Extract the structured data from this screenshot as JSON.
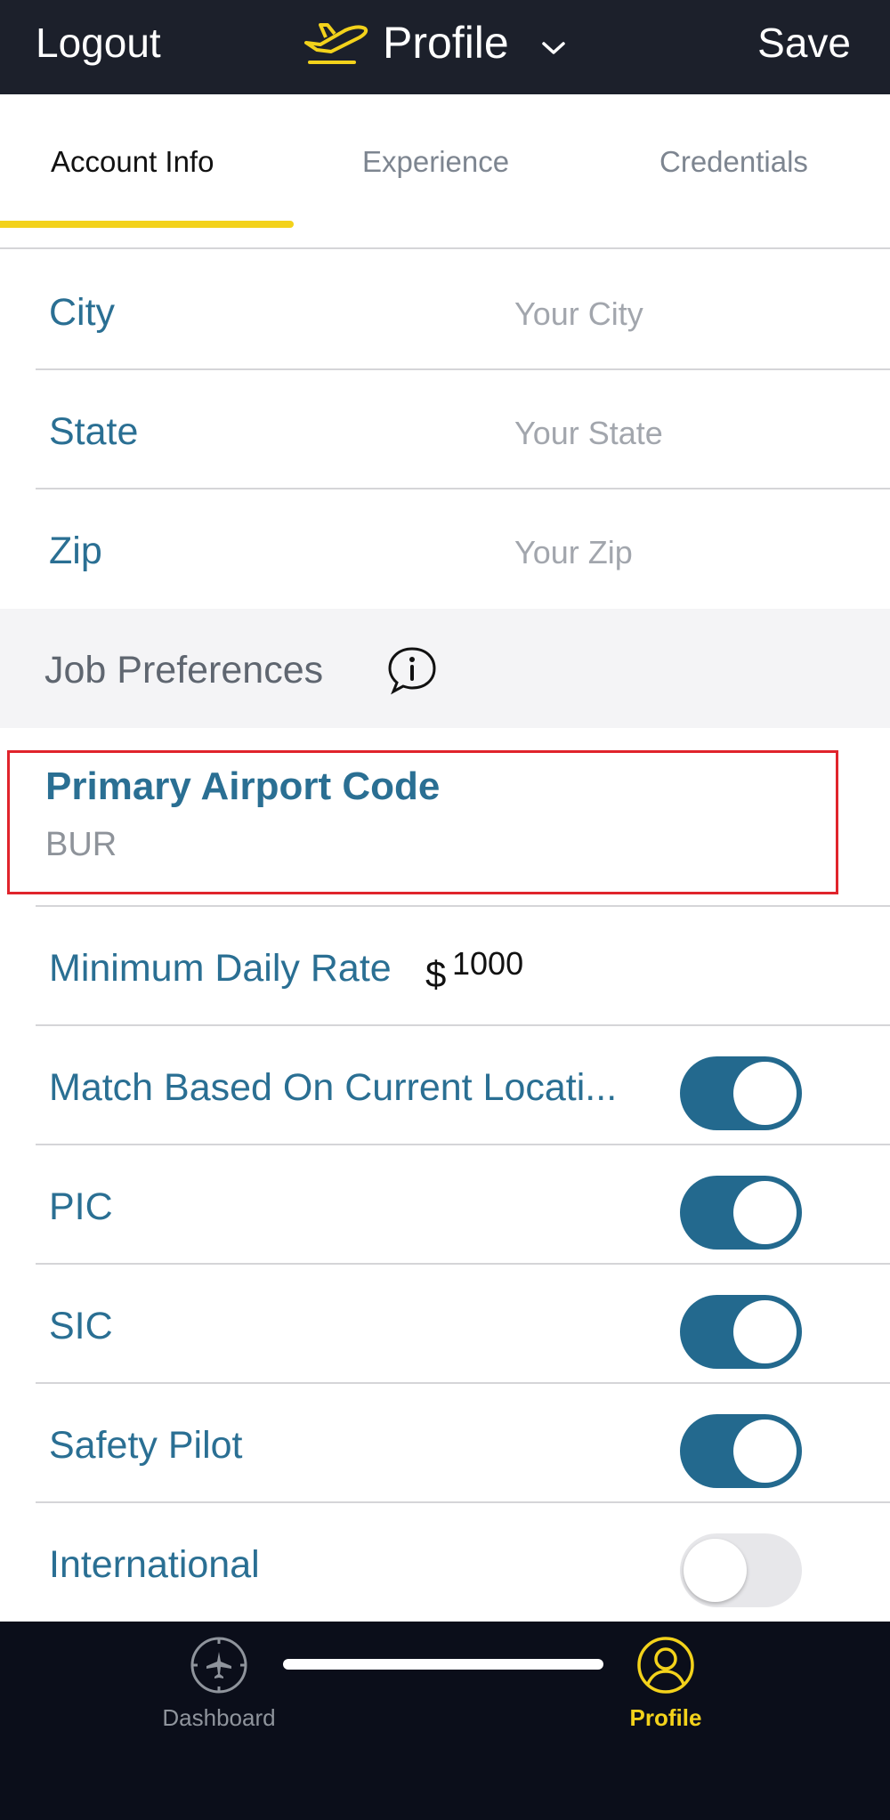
{
  "header": {
    "logout_label": "Logout",
    "title": "Profile",
    "save_label": "Save"
  },
  "tabs": [
    {
      "label": "Account Info",
      "active": true
    },
    {
      "label": "Experience",
      "active": false
    },
    {
      "label": "Credentials",
      "active": false
    }
  ],
  "address_fields": [
    {
      "label": "City",
      "placeholder": "Your City"
    },
    {
      "label": "State",
      "placeholder": "Your State"
    },
    {
      "label": "Zip",
      "placeholder": "Your Zip"
    }
  ],
  "job_preferences": {
    "heading": "Job Preferences",
    "primary_airport": {
      "label": "Primary Airport Code",
      "value": "BUR"
    },
    "minimum_rate": {
      "label": "Minimum Daily Rate",
      "currency": "$",
      "value": "1000"
    },
    "toggles": [
      {
        "label": "Match Based On Current Locati...",
        "on": true
      },
      {
        "label": "PIC",
        "on": true
      },
      {
        "label": "SIC",
        "on": true
      },
      {
        "label": "Safety Pilot",
        "on": true
      },
      {
        "label": "International",
        "on": false
      }
    ]
  },
  "bottom_nav": [
    {
      "label": "Dashboard",
      "icon": "compass-plane-icon",
      "active": false
    },
    {
      "label": "Profile",
      "icon": "user-circle-icon",
      "active": true
    }
  ],
  "colors": {
    "accent_yellow": "#f3d21b",
    "label_blue": "#2a6f93",
    "toggle_on": "#23698e",
    "highlight_red": "#e0242c",
    "nav_dark": "#1c202b"
  }
}
